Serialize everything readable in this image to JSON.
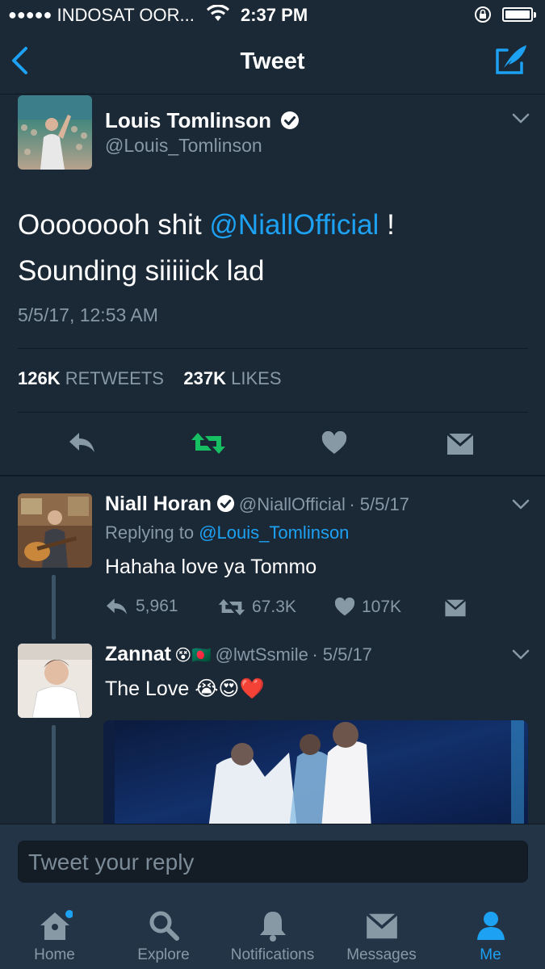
{
  "status_bar": {
    "signal_dots": "●●●●●",
    "carrier": "INDOSAT OOR...",
    "time": "2:37 PM"
  },
  "nav": {
    "title": "Tweet"
  },
  "main_tweet": {
    "author_name": "Louis Tomlinson",
    "author_handle": "@Louis_Tomlinson",
    "text_part1": "Oooooooh shit ",
    "mention": "@NiallOfficial",
    "text_part2": " !",
    "text_line2": "Sounding siiiiick lad",
    "timestamp": "5/5/17, 12:53 AM",
    "retweet_count": "126K",
    "retweet_label": "RETWEETS",
    "like_count": "237K",
    "like_label": "LIKES"
  },
  "replies": [
    {
      "name": "Niall Horan",
      "handle": "@NiallOfficial",
      "date": "· 5/5/17",
      "replying_label": "Replying to",
      "replying_to": "@Louis_Tomlinson",
      "text": "Hahaha love ya Tommo",
      "reply_count": "5,961",
      "retweet_count": "67.3K",
      "like_count": "107K"
    },
    {
      "name": "Zannat",
      "name_emoji": "😵🇧🇩",
      "handle": "@lwtSsmile",
      "date": "· 5/5/17",
      "text": "The Love",
      "text_emoji": "😭😍❤️"
    }
  ],
  "reply_box": {
    "placeholder": "Tweet your reply"
  },
  "tabs": [
    {
      "label": "Home",
      "icon": "home-icon"
    },
    {
      "label": "Explore",
      "icon": "search-icon"
    },
    {
      "label": "Notifications",
      "icon": "bell-icon"
    },
    {
      "label": "Messages",
      "icon": "envelope-icon"
    },
    {
      "label": "Me",
      "icon": "person-icon",
      "active": true
    }
  ],
  "colors": {
    "background": "#1b2836",
    "accent": "#1da1f2",
    "retweet_active": "#17bf63",
    "muted": "#8899a6",
    "bar": "#243447"
  }
}
